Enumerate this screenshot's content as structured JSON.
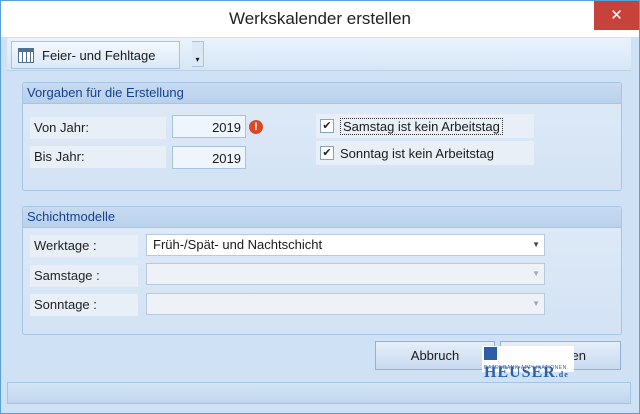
{
  "window": {
    "title": "Werkskalender erstellen",
    "close_glyph": "✕"
  },
  "toolbar": {
    "button_label": "Feier- und Fehltage",
    "button_icon": "calendar-icon",
    "dropdown_glyph": "▾"
  },
  "vorgaben": {
    "title": "Vorgaben für die Erstellung",
    "von_label": "Von Jahr:",
    "von_value": "2019",
    "warning_glyph": "!",
    "bis_label": "Bis Jahr:",
    "bis_value": "2019",
    "samstag_label": "Samstag ist kein Arbeitstag",
    "sonntag_label": "Sonntag ist kein Arbeitstag",
    "check_glyph": "✔"
  },
  "schicht": {
    "title": "Schichtmodelle",
    "werktage_label": "Werktage :",
    "werktage_value": "Früh-/Spät- und Nachtschicht",
    "samstage_label": "Samstage :",
    "samstage_value": "",
    "sonntage_label": "Sonntage :",
    "sonntage_value": "",
    "arrow_glyph": "▼"
  },
  "buttons": {
    "abbruch": "Abbruch",
    "ok_partial": "en"
  },
  "logo": {
    "name": "HEUSER",
    "suffix": ".de",
    "tagline": "DATENBANK-APPLIKATIONEN"
  },
  "colors": {
    "accent": "#5aa0d8",
    "close": "#c7423a",
    "warning": "#d84a25",
    "group_title": "#15428b"
  }
}
